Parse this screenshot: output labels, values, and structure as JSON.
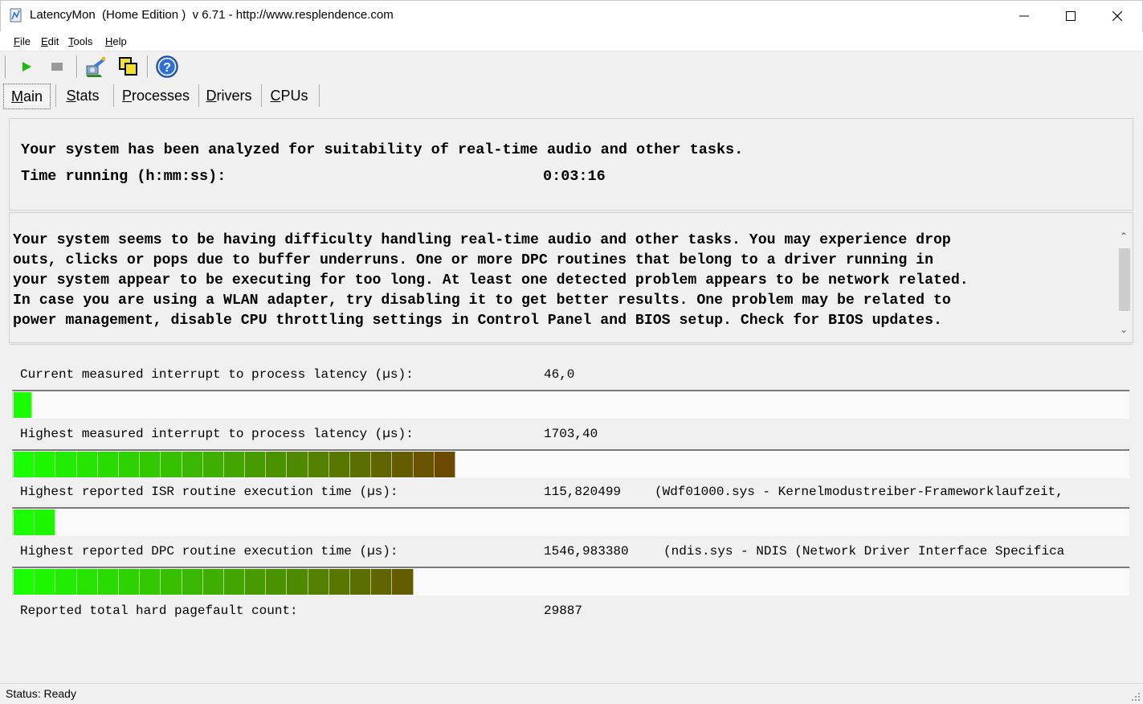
{
  "window": {
    "title": "LatencyMon  (Home Edition )  v 6.71 - http://www.resplendence.com",
    "minimize": "—",
    "maximize": "☐",
    "close": "✕"
  },
  "menu": [
    {
      "key": "F",
      "rest": "ile"
    },
    {
      "key": "E",
      "rest": "dit"
    },
    {
      "key": "T",
      "rest": "ools"
    },
    {
      "key": "H",
      "rest": "elp"
    }
  ],
  "toolbar": {
    "icons": [
      "play-icon",
      "stop-icon",
      "driver-wizard-icon",
      "copy-windows-icon",
      "help-icon"
    ],
    "help_glyph": "?"
  },
  "tabs": [
    {
      "key": "M",
      "rest": "ain",
      "active": true
    },
    {
      "key": "S",
      "rest": "tats",
      "active": false
    },
    {
      "key": "P",
      "rest": "rocesses",
      "active": false
    },
    {
      "key": "D",
      "rest": "rivers",
      "active": false
    },
    {
      "key": "C",
      "rest": "PUs",
      "active": false
    }
  ],
  "summary": {
    "headline": "Your system has been analyzed for suitability of real-time audio and other tasks.",
    "time_label": "Time running (h:mm:ss):",
    "time_value": "0:03:16"
  },
  "message": {
    "lines": [
      "Your system seems to be having difficulty handling real-time audio and other tasks. You may experience drop",
      "outs, clicks or pops due to buffer underruns. One or more DPC routines that belong to a driver running in",
      "your system appear to be executing for too long. At least one detected problem appears to be network related.",
      "In case you are using a WLAN adapter, try disabling it to get better results. One problem may be related to",
      "power management, disable CPU throttling settings in Control Panel and BIOS setup. Check for BIOS updates."
    ],
    "scroll_up": "⌃",
    "scroll_down": "⌄"
  },
  "stats": [
    {
      "label": "Current measured interrupt to process latency (µs):",
      "value": "46,0",
      "detail": "",
      "bar_segments": 1
    },
    {
      "label": "Highest measured interrupt to process latency (µs):",
      "value": "1703,40",
      "detail": "",
      "bar_segments": 21
    },
    {
      "label": "Highest reported ISR routine execution time (µs):",
      "value": "115,820499",
      "detail": "(Wdf01000.sys - Kernelmodustreiber-Frameworklaufzeit,",
      "bar_segments": 2
    },
    {
      "label": "Highest reported DPC routine execution time (µs):",
      "value": "1546,983380",
      "detail": "(ndis.sys - NDIS (Network Driver Interface Specifica",
      "bar_segments": 19
    },
    {
      "label": "Reported total hard pagefault count:",
      "value": "29887",
      "detail": "",
      "bar_segments": 0
    }
  ],
  "colors": {
    "bar_start": "#1aff00",
    "bar_end": "#6b4a00",
    "status_ok": "#00b000"
  },
  "status": {
    "text": "Status: Ready"
  }
}
